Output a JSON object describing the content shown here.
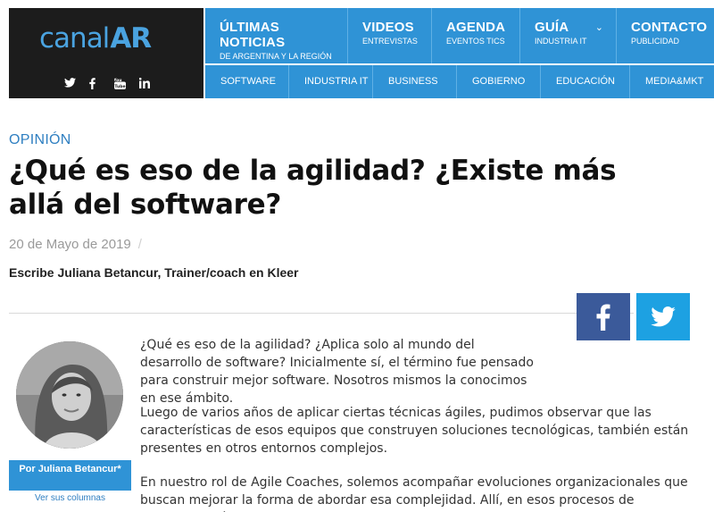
{
  "header": {
    "logo_text": "canal",
    "logo_suffix": "AR",
    "socials": [
      "twitter-icon",
      "facebook-icon",
      "youtube-icon",
      "linkedin-icon"
    ],
    "nav_top": [
      {
        "title": "ÚLTIMAS NOTICIAS",
        "sub": "DE ARGENTINA Y LA REGIÓN"
      },
      {
        "title": "VIDEOS",
        "sub": "ENTREVISTAS"
      },
      {
        "title": "AGENDA",
        "sub": "EVENTOS TICS"
      },
      {
        "title": "GUÍA",
        "sub": "INDUSTRIA IT",
        "chevron": "⌄"
      },
      {
        "title": "CONTACTO",
        "sub": "PUBLICIDAD"
      }
    ],
    "nav_bottom": [
      "SOFTWARE",
      "INDUSTRIA IT",
      "BUSINESS",
      "GOBIERNO",
      "EDUCACIÓN",
      "MEDIA&MKT"
    ]
  },
  "article": {
    "section": "OPINIÓN",
    "title": "¿Qué es eso de la agilidad? ¿Existe más allá del software?",
    "date": "20 de Mayo de 2019",
    "date_sep": "/",
    "byline": "Escribe Juliana Betancur, Trainer/coach en Kleer",
    "paragraphs": [
      "¿Qué es eso de la agilidad? ¿Aplica solo al mundo del desarrollo de software? Inicialmente sí, el término fue pensado para construir mejor software. Nosotros mismos la conocimos en ese ámbito.",
      "Luego de varios años de aplicar ciertas técnicas ágiles, pudimos observar que las características de esos equipos que construyen soluciones tecnológicas, también están presentes en otros entornos complejos.",
      "En nuestro rol de Agile Coaches, solemos acompañar evoluciones organizacionales que buscan mejorar la forma de abordar esa complejidad. Allí, en esos procesos de transformación"
    ]
  },
  "author": {
    "name": "Por Juliana Betancur*",
    "link": "Ver sus columnas"
  },
  "share": [
    "facebook-share",
    "twitter-share"
  ],
  "colors": {
    "brand_blue": "#2f93d6",
    "facebook": "#3b5a9a",
    "twitter": "#1da1e2",
    "logo_bg": "#1c1c1c"
  }
}
